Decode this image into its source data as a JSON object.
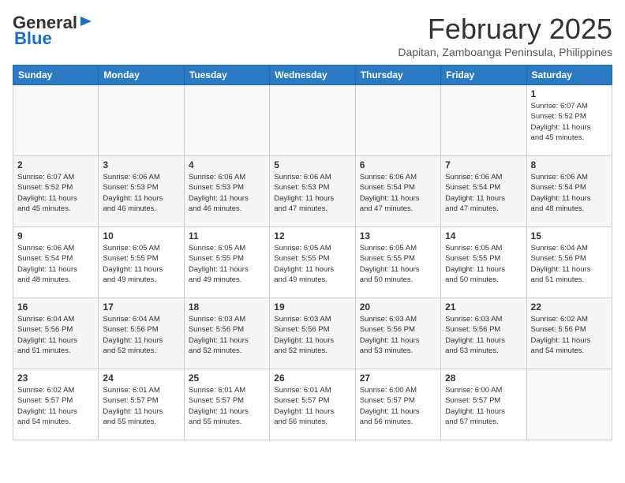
{
  "header": {
    "logo_general": "General",
    "logo_blue": "Blue",
    "month_title": "February 2025",
    "subtitle": "Dapitan, Zamboanga Peninsula, Philippines"
  },
  "weekdays": [
    "Sunday",
    "Monday",
    "Tuesday",
    "Wednesday",
    "Thursday",
    "Friday",
    "Saturday"
  ],
  "weeks": [
    {
      "days": [
        {
          "num": "",
          "info": ""
        },
        {
          "num": "",
          "info": ""
        },
        {
          "num": "",
          "info": ""
        },
        {
          "num": "",
          "info": ""
        },
        {
          "num": "",
          "info": ""
        },
        {
          "num": "",
          "info": ""
        },
        {
          "num": "1",
          "info": "Sunrise: 6:07 AM\nSunset: 5:52 PM\nDaylight: 11 hours\nand 45 minutes."
        }
      ]
    },
    {
      "days": [
        {
          "num": "2",
          "info": "Sunrise: 6:07 AM\nSunset: 5:52 PM\nDaylight: 11 hours\nand 45 minutes."
        },
        {
          "num": "3",
          "info": "Sunrise: 6:06 AM\nSunset: 5:53 PM\nDaylight: 11 hours\nand 46 minutes."
        },
        {
          "num": "4",
          "info": "Sunrise: 6:06 AM\nSunset: 5:53 PM\nDaylight: 11 hours\nand 46 minutes."
        },
        {
          "num": "5",
          "info": "Sunrise: 6:06 AM\nSunset: 5:53 PM\nDaylight: 11 hours\nand 47 minutes."
        },
        {
          "num": "6",
          "info": "Sunrise: 6:06 AM\nSunset: 5:54 PM\nDaylight: 11 hours\nand 47 minutes."
        },
        {
          "num": "7",
          "info": "Sunrise: 6:06 AM\nSunset: 5:54 PM\nDaylight: 11 hours\nand 47 minutes."
        },
        {
          "num": "8",
          "info": "Sunrise: 6:06 AM\nSunset: 5:54 PM\nDaylight: 11 hours\nand 48 minutes."
        }
      ]
    },
    {
      "days": [
        {
          "num": "9",
          "info": "Sunrise: 6:06 AM\nSunset: 5:54 PM\nDaylight: 11 hours\nand 48 minutes."
        },
        {
          "num": "10",
          "info": "Sunrise: 6:05 AM\nSunset: 5:55 PM\nDaylight: 11 hours\nand 49 minutes."
        },
        {
          "num": "11",
          "info": "Sunrise: 6:05 AM\nSunset: 5:55 PM\nDaylight: 11 hours\nand 49 minutes."
        },
        {
          "num": "12",
          "info": "Sunrise: 6:05 AM\nSunset: 5:55 PM\nDaylight: 11 hours\nand 49 minutes."
        },
        {
          "num": "13",
          "info": "Sunrise: 6:05 AM\nSunset: 5:55 PM\nDaylight: 11 hours\nand 50 minutes."
        },
        {
          "num": "14",
          "info": "Sunrise: 6:05 AM\nSunset: 5:55 PM\nDaylight: 11 hours\nand 50 minutes."
        },
        {
          "num": "15",
          "info": "Sunrise: 6:04 AM\nSunset: 5:56 PM\nDaylight: 11 hours\nand 51 minutes."
        }
      ]
    },
    {
      "days": [
        {
          "num": "16",
          "info": "Sunrise: 6:04 AM\nSunset: 5:56 PM\nDaylight: 11 hours\nand 51 minutes."
        },
        {
          "num": "17",
          "info": "Sunrise: 6:04 AM\nSunset: 5:56 PM\nDaylight: 11 hours\nand 52 minutes."
        },
        {
          "num": "18",
          "info": "Sunrise: 6:03 AM\nSunset: 5:56 PM\nDaylight: 11 hours\nand 52 minutes."
        },
        {
          "num": "19",
          "info": "Sunrise: 6:03 AM\nSunset: 5:56 PM\nDaylight: 11 hours\nand 52 minutes."
        },
        {
          "num": "20",
          "info": "Sunrise: 6:03 AM\nSunset: 5:56 PM\nDaylight: 11 hours\nand 53 minutes."
        },
        {
          "num": "21",
          "info": "Sunrise: 6:03 AM\nSunset: 5:56 PM\nDaylight: 11 hours\nand 53 minutes."
        },
        {
          "num": "22",
          "info": "Sunrise: 6:02 AM\nSunset: 5:56 PM\nDaylight: 11 hours\nand 54 minutes."
        }
      ]
    },
    {
      "days": [
        {
          "num": "23",
          "info": "Sunrise: 6:02 AM\nSunset: 5:57 PM\nDaylight: 11 hours\nand 54 minutes."
        },
        {
          "num": "24",
          "info": "Sunrise: 6:01 AM\nSunset: 5:57 PM\nDaylight: 11 hours\nand 55 minutes."
        },
        {
          "num": "25",
          "info": "Sunrise: 6:01 AM\nSunset: 5:57 PM\nDaylight: 11 hours\nand 55 minutes."
        },
        {
          "num": "26",
          "info": "Sunrise: 6:01 AM\nSunset: 5:57 PM\nDaylight: 11 hours\nand 56 minutes."
        },
        {
          "num": "27",
          "info": "Sunrise: 6:00 AM\nSunset: 5:57 PM\nDaylight: 11 hours\nand 56 minutes."
        },
        {
          "num": "28",
          "info": "Sunrise: 6:00 AM\nSunset: 5:57 PM\nDaylight: 11 hours\nand 57 minutes."
        },
        {
          "num": "",
          "info": ""
        }
      ]
    }
  ]
}
